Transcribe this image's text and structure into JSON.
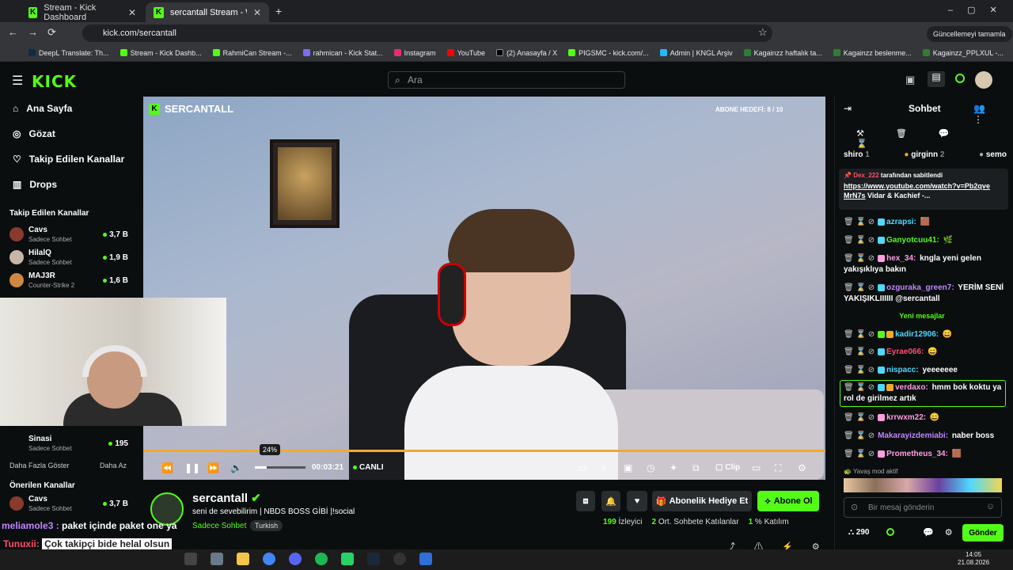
{
  "browser": {
    "tabs": [
      {
        "label": "Stream - Kick Dashboard",
        "active": false
      },
      {
        "label": "sercantall Stream - Watch L",
        "active": true
      }
    ],
    "url": "kick.com/sercantall",
    "update_label": "Güncellemeyi tamamla",
    "bookmarks": [
      "DeepL Translate: Th...",
      "Stream - Kick Dashb...",
      "RahmiCan Stream -...",
      "rahmican - Kick Stat...",
      "Instagram",
      "YouTube",
      "(2) Anasayfa / X",
      "PIGSMC - kick.com/...",
      "Admin | KNGL Arşiv",
      "Kagainzz haftalık ta...",
      "Kagainzz beslenme...",
      "Kagainzz_PPLXUL -..."
    ]
  },
  "header": {
    "logo": "KICK",
    "search_placeholder": "Ara"
  },
  "sidebar": {
    "nav": [
      "Ana Sayfa",
      "Gözat",
      "Takip Edilen Kanallar",
      "Drops"
    ],
    "followed_title": "Takip Edilen Kanallar",
    "followed": [
      {
        "name": "Cavs",
        "game": "Sadece Sohbet",
        "viewers": "3,7 B"
      },
      {
        "name": "HilalQ",
        "game": "Sadece Sohbet",
        "viewers": "1,9 B"
      },
      {
        "name": "MAJ3R",
        "game": "Counter-Strike 2",
        "viewers": "1,6 B"
      },
      {
        "name": "Sinasi",
        "game": "Sadece Sohbet",
        "viewers": "195"
      }
    ],
    "show_more": "Daha Fazla Göster",
    "show_less": "Daha Az",
    "recommended_title": "Önerilen Kanallar",
    "recommended": [
      {
        "name": "Cavs",
        "game": "Sadece Sohbet",
        "viewers": "3,7 B"
      }
    ]
  },
  "player": {
    "channel_badge": "SERCANTALL",
    "sub_goal": "ABONE HEDEFİ: 8 / 10",
    "volume_tip": "24%",
    "time": "00:03:21",
    "live": "CANLI",
    "clip": "Clip",
    "volume_level": 0.24
  },
  "overlay": {
    "line1_user": "meliamole3 : ",
    "line1": "paket içinde paket one ya",
    "line2_user": "Tunuxii: ",
    "line2": "Çok takipçi bide helal olsun"
  },
  "stream": {
    "name": "sercantall",
    "title": "seni de sevebilirim | NBDS BOSS GİBİ |!social",
    "category": "Sadece Sohbet",
    "language": "Turkish",
    "gift_label": "Abonelik Hediye Et",
    "sub_label": "Abone Ol",
    "viewers": "199",
    "viewers_label": "İzleyici",
    "avg_chat": "2",
    "avg_chat_label": "Ort. Sohbete Katılanlar",
    "participation": "1",
    "participation_label": "% Katılım"
  },
  "chat": {
    "title": "Sohbet",
    "top_users": [
      {
        "name": "shiro",
        "count": "1"
      },
      {
        "name": "girginn",
        "count": "2"
      },
      {
        "name": "semo",
        "count": ""
      }
    ],
    "pinned": {
      "by": "Dex_222",
      "by_suffix": "tarafından sabitlendi",
      "link": "https://www.youtube.com/watch?v=Pb2qveMrN7s",
      "rest": "Vidar & Kachief -..."
    },
    "messages": [
      {
        "user": "azrapsi:",
        "text": "",
        "color": "#4ed9ff"
      },
      {
        "user": "Ganyotcuu41:",
        "text": "",
        "color": "#53fc18"
      },
      {
        "user": "hex_34:",
        "text": "kngla yeni gelen yakışıklıya bakın",
        "color": "#ff9ee0"
      },
      {
        "user": "ozguraka_green7:",
        "text": "YERİM SENİ YAKIŞIKLIIIIII @sercantall",
        "color": "#c085ff"
      }
    ],
    "new_messages": "Yeni mesajlar",
    "messages2": [
      {
        "user": "kadir12906:",
        "text": "",
        "color": "#4ed9ff"
      },
      {
        "user": "Eyrae066:",
        "text": "",
        "color": "#ff4d6b"
      },
      {
        "user": "nispacc:",
        "text": "yeeeeeee",
        "color": "#4ed9ff"
      },
      {
        "user": "verdaxo:",
        "text": "hmm bok koktu ya rol de girilmez artık",
        "color": "#ff9ee0"
      },
      {
        "user": "krrwxm22:",
        "text": "",
        "color": "#ff9ee0"
      },
      {
        "user": "Makarayizdemiabi:",
        "text": "naber boss",
        "color": "#c085ff"
      },
      {
        "user": "Prometheus_34:",
        "text": "",
        "color": "#ff9ee0"
      }
    ],
    "slow_mode": "Yavaş mod aktif",
    "input_placeholder": "Bir mesaj gönderin",
    "points": "290",
    "send": "Gönder"
  },
  "taskbar": {
    "time": "14:05",
    "date": "21.08.2026"
  },
  "colors": {
    "accent": "#53fc18",
    "bg": "#0b0e0f"
  }
}
